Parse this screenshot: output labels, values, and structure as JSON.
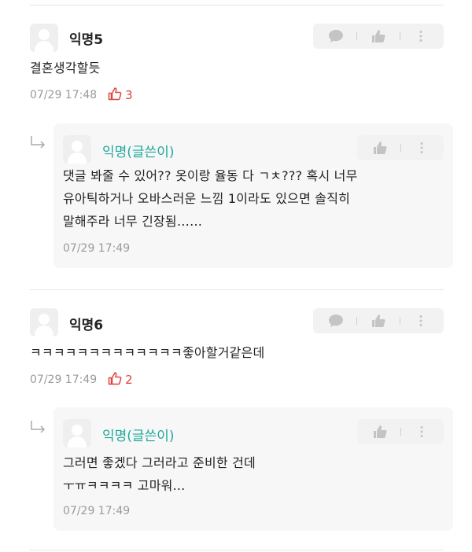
{
  "comments": [
    {
      "author": "익명5",
      "text": "결혼생각할듯",
      "time": "07/29 17:48",
      "likes": "3",
      "reply": {
        "author": "익명(글쓴이)",
        "lines": [
          "댓글 봐줄 수 있어?? 옷이랑 율동 다 ㄱㅊ??? 혹시 너무",
          "유아틱하거나 오바스러운 느낌 1이라도 있으면 솔직히",
          "말해주라 너무 긴장됨……"
        ],
        "time": "07/29 17:49"
      }
    },
    {
      "author": "익명6",
      "text": "ㅋㅋㅋㅋㅋㅋㅋㅋㅋㅋㅋㅋㅋ좋아할거같은데",
      "time": "07/29 17:49",
      "likes": "2",
      "reply": {
        "author": "익명(글쓴이)",
        "lines": [
          "그러면 좋겠다 그러라고 준비한 건데",
          "ㅜㅠㅋㅋㅋㅋ 고마워..."
        ],
        "time": "07/29 17:49"
      }
    }
  ],
  "icons": {
    "comment": "speech-bubble-icon",
    "like": "thumbs-up-icon",
    "more": "vertical-dots-icon",
    "reply": "reply-arrow-icon"
  },
  "colors": {
    "writer_name": "#1ea99b",
    "like_count": "#e0443c",
    "action_bg": "#f2f2f2",
    "reply_bg": "#f7f7f7"
  }
}
